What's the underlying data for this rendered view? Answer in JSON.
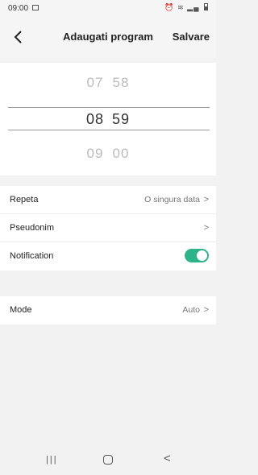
{
  "status": {
    "time": "09:00",
    "icons": [
      "image-icon",
      "alarm-icon",
      "wifi-icon",
      "signal-icon",
      "battery-icon"
    ]
  },
  "header": {
    "title": "Adaugati program",
    "save_label": "Salvare",
    "back_icon": "back-arrow-icon"
  },
  "time_picker": {
    "prev": {
      "hour": "07",
      "minute": "58"
    },
    "selected": {
      "hour": "08",
      "minute": "59"
    },
    "next": {
      "hour": "09",
      "minute": "00"
    }
  },
  "settings": {
    "repeat": {
      "label": "Repeta",
      "value": "O singura data"
    },
    "alias": {
      "label": "Pseudonim",
      "value": ""
    },
    "notification": {
      "label": "Notification",
      "enabled": true,
      "color": "#2cb38a"
    },
    "mode": {
      "label": "Mode",
      "value": "Auto"
    }
  },
  "nav": {
    "recent_label": "|||",
    "back_label": "<"
  }
}
